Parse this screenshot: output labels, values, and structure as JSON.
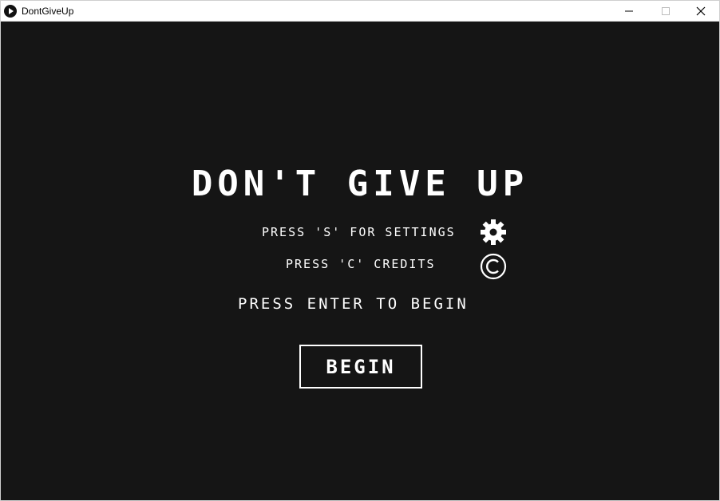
{
  "window": {
    "title": "DontGiveUp",
    "app_icon": "play-icon",
    "controls": [
      "minimize-icon",
      "maximize-icon",
      "close-icon"
    ]
  },
  "game": {
    "title": "DON'T GIVE UP",
    "settings_hint": "PRESS 'S' FOR SETTINGS",
    "settings_icon": "gear-icon",
    "credits_hint": "PRESS 'C' CREDITS",
    "credits_icon": "copyright-icon",
    "enter_hint": "PRESS ENTER TO BEGIN",
    "begin_label": "BEGIN"
  },
  "colors": {
    "background": "#151515",
    "foreground": "#ffffff"
  }
}
